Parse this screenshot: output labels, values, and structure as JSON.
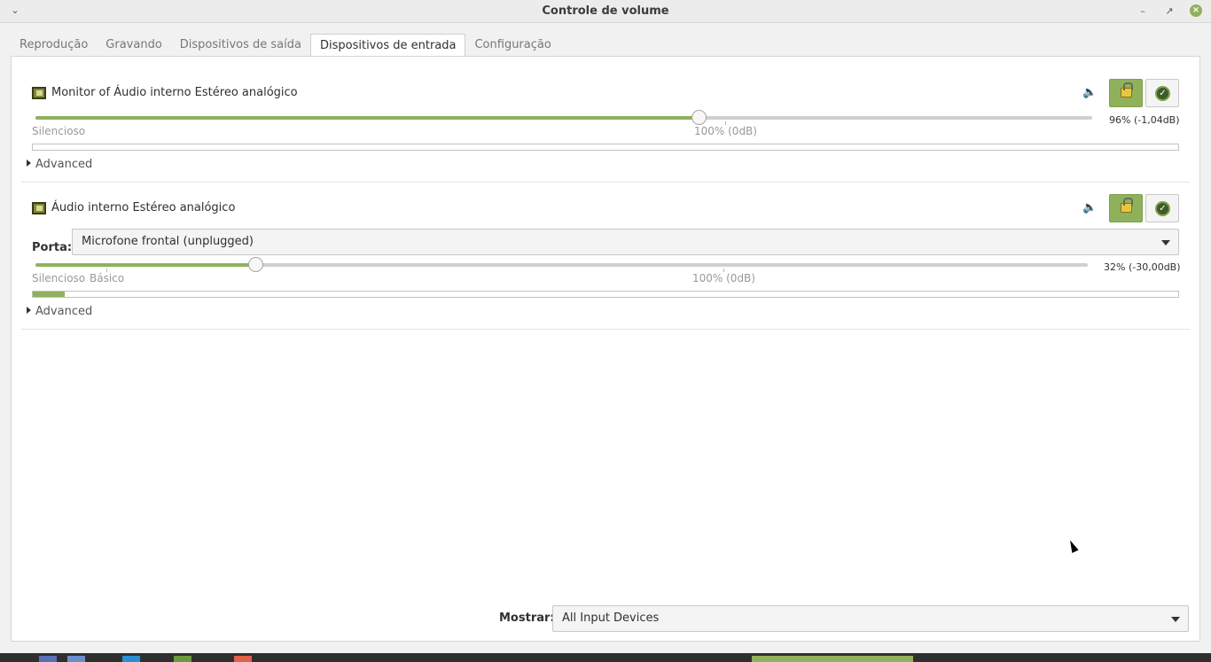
{
  "window": {
    "title": "Controle de volume",
    "menu_icon": "chevron-down-icon",
    "minimize_icon": "minimize-icon",
    "maximize_icon": "maximize-icon",
    "close_icon": "close-icon"
  },
  "tabs": [
    {
      "label": "Reprodução",
      "active": false
    },
    {
      "label": "Gravando",
      "active": false
    },
    {
      "label": "Dispositivos de saída",
      "active": false
    },
    {
      "label": "Dispositivos de entrada",
      "active": true
    },
    {
      "label": "Configuração",
      "active": false
    }
  ],
  "devices": [
    {
      "name": "Monitor of Áudio interno Estéreo analógico",
      "volume_fraction": 0.96,
      "volume_text": "96% (-1,04dB)",
      "scale_left": "Silencioso",
      "scale_base": "",
      "scale_100": "100% (0dB)",
      "peak_fraction": 0.0,
      "advanced_label": "Advanced",
      "locked": true
    },
    {
      "name": "Áudio interno Estéreo analógico",
      "port_label": "Porta:",
      "port_value": "Microfone frontal (unplugged)",
      "volume_fraction": 0.32,
      "volume_text": "32% (-30,00dB)",
      "scale_left": "Silencioso",
      "scale_base": "Básico",
      "scale_100": "100% (0dB)",
      "peak_fraction": 0.028,
      "advanced_label": "Advanced",
      "locked": true
    }
  ],
  "footer": {
    "show_label": "Mostrar:",
    "show_value": "All Input Devices"
  },
  "colors": {
    "accent": "#8fb15c",
    "titlebar": "#ececec",
    "taskbar": "#2f2f2f"
  }
}
